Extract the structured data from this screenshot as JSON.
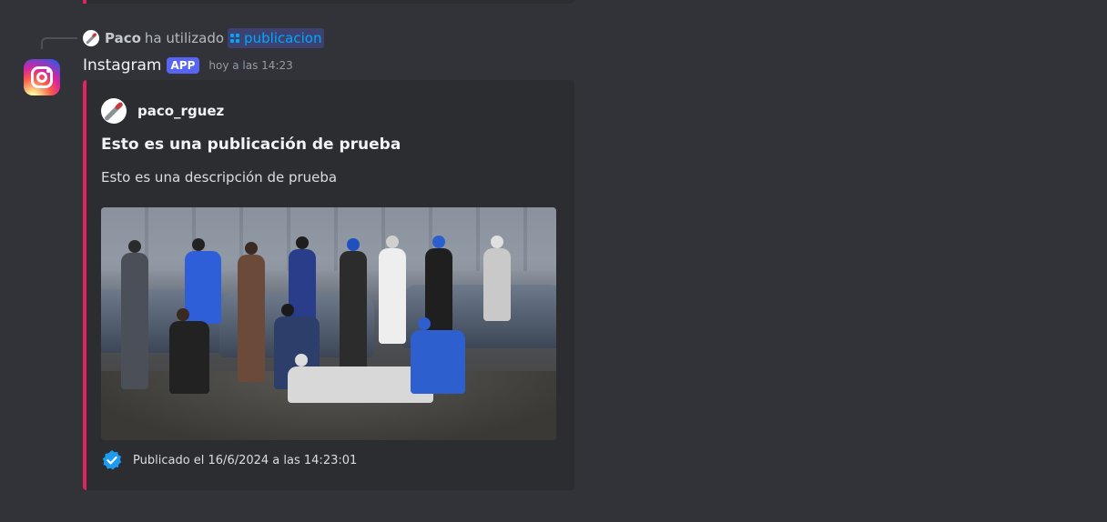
{
  "reply": {
    "user": "Paco",
    "action_text": "ha utilizado",
    "command": "publicacion"
  },
  "message": {
    "app_name": "Instagram",
    "app_badge": "APP",
    "timestamp": "hoy a las 14:23",
    "avatar_icon": "instagram-icon"
  },
  "embed": {
    "accent_color": "#e0245e",
    "author_name": "paco_rguez",
    "title": "Esto es una publicación de prueba",
    "description": "Esto es una descripción de prueba",
    "footer_icon": "verified-badge-icon",
    "footer_text": "Publicado el 16/6/2024 a las 14:23:01"
  },
  "colors": {
    "background": "#313338",
    "embed_background": "#2b2d31",
    "app_badge": "#5865f2",
    "command_link": "#00a8fc",
    "verified": "#1d9bf0"
  }
}
